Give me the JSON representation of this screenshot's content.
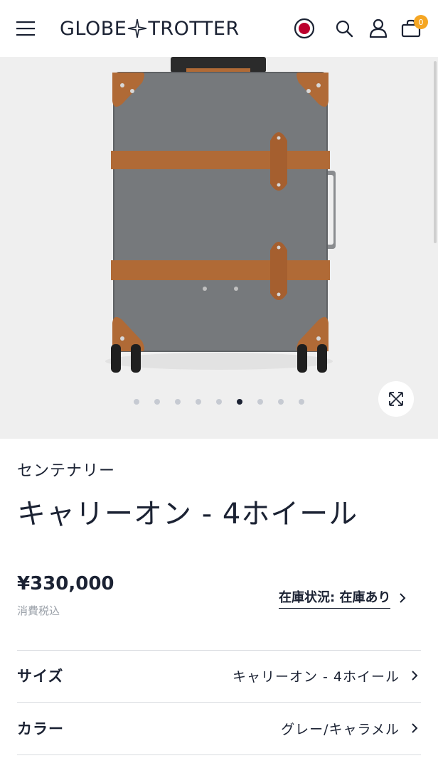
{
  "header": {
    "logo_left": "GLOBE",
    "logo_right": "TROTTER",
    "cart_count": "0",
    "icons": [
      "menu-icon",
      "japan-flag-icon",
      "search-icon",
      "account-icon",
      "cart-icon"
    ]
  },
  "gallery": {
    "image": "suitcase-image",
    "dot_count": 9,
    "active_dot_index": 5,
    "zoom_icon": "expand-icon"
  },
  "product": {
    "collection": "センテナリー",
    "title": "キャリーオン - 4ホイール",
    "price": "¥330,000",
    "tax_note": "消費税込",
    "stock_label": "在庫状況: 在庫あり"
  },
  "options": [
    {
      "label": "サイズ",
      "value": "キャリーオン - 4ホイール"
    },
    {
      "label": "カラー",
      "value": "グレー/キャラメル"
    }
  ],
  "colors": {
    "text": "#1b2233",
    "badge": "#f5a623",
    "flag_red": "#bc002d",
    "suitcase_body": "#76797c",
    "leather": "#b06a36"
  }
}
